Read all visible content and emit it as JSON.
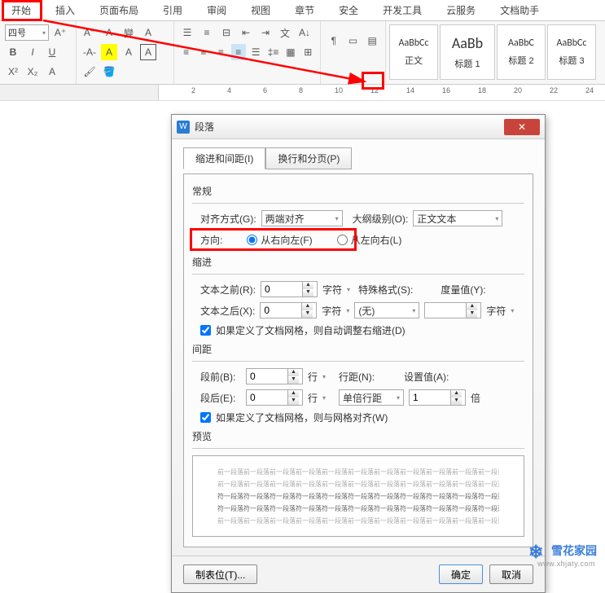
{
  "menu": [
    "开始",
    "插入",
    "页面布局",
    "引用",
    "审阅",
    "视图",
    "章节",
    "安全",
    "开发工具",
    "云服务",
    "文档助手"
  ],
  "fontSize": "四号",
  "styles": [
    {
      "preview": "AaBbCc",
      "name": "正文"
    },
    {
      "preview": "AaBb",
      "name": "标题 1",
      "big": true
    },
    {
      "preview": "AaBbC",
      "name": "标题 2"
    },
    {
      "preview": "AaBbCc",
      "name": "标题 3"
    }
  ],
  "rulerTicks": [
    "2",
    "4",
    "6",
    "8",
    "10",
    "12",
    "14",
    "16",
    "18",
    "20",
    "22",
    "24"
  ],
  "dialog": {
    "title": "段落",
    "tabs": {
      "indent": "缩进和间距(I)",
      "page": "换行和分页(P)"
    },
    "general": {
      "title": "常规",
      "alignLabel": "对齐方式(G):",
      "alignValue": "两端对齐",
      "outlineLabel": "大纲级别(O):",
      "outlineValue": "正文文本",
      "dirLabel": "方向:",
      "dirR2L": "从右向左(F)",
      "dirL2R": "从左向右(L)"
    },
    "indent": {
      "title": "缩进",
      "beforeLabel": "文本之前(R):",
      "beforeVal": "0",
      "afterLabel": "文本之后(X):",
      "afterVal": "0",
      "unitChar": "字符",
      "specialLabel": "特殊格式(S):",
      "specialVal": "(无)",
      "metricLabel": "度量值(Y):",
      "autoAdjust": "如果定义了文档网格，则自动调整右缩进(D)"
    },
    "spacing": {
      "title": "间距",
      "beforeLabel": "段前(B):",
      "beforeVal": "0",
      "afterLabel": "段后(E):",
      "afterVal": "0",
      "unitLine": "行",
      "lineSpaceLabel": "行距(N):",
      "lineSpaceVal": "单倍行距",
      "setValLabel": "设置值(A):",
      "setVal": "1",
      "unitTimes": "倍",
      "gridAlign": "如果定义了文档网格，则与网格对齐(W)"
    },
    "preview": {
      "title": "预览",
      "light": "前一段落前一段落前一段落前一段落前一段落前一段落前一段落前一段落前一段落前一段落前一段落",
      "dark": "符一段落符一段落符一段落符一段落符一段落符一段落符一段落符一段落符一段落符一段落符一段落"
    },
    "tabstops": "制表位(T)...",
    "ok": "确定",
    "cancel": "取消"
  },
  "watermark": {
    "name": "雪花家园",
    "url": "www.xhjaty.com"
  }
}
